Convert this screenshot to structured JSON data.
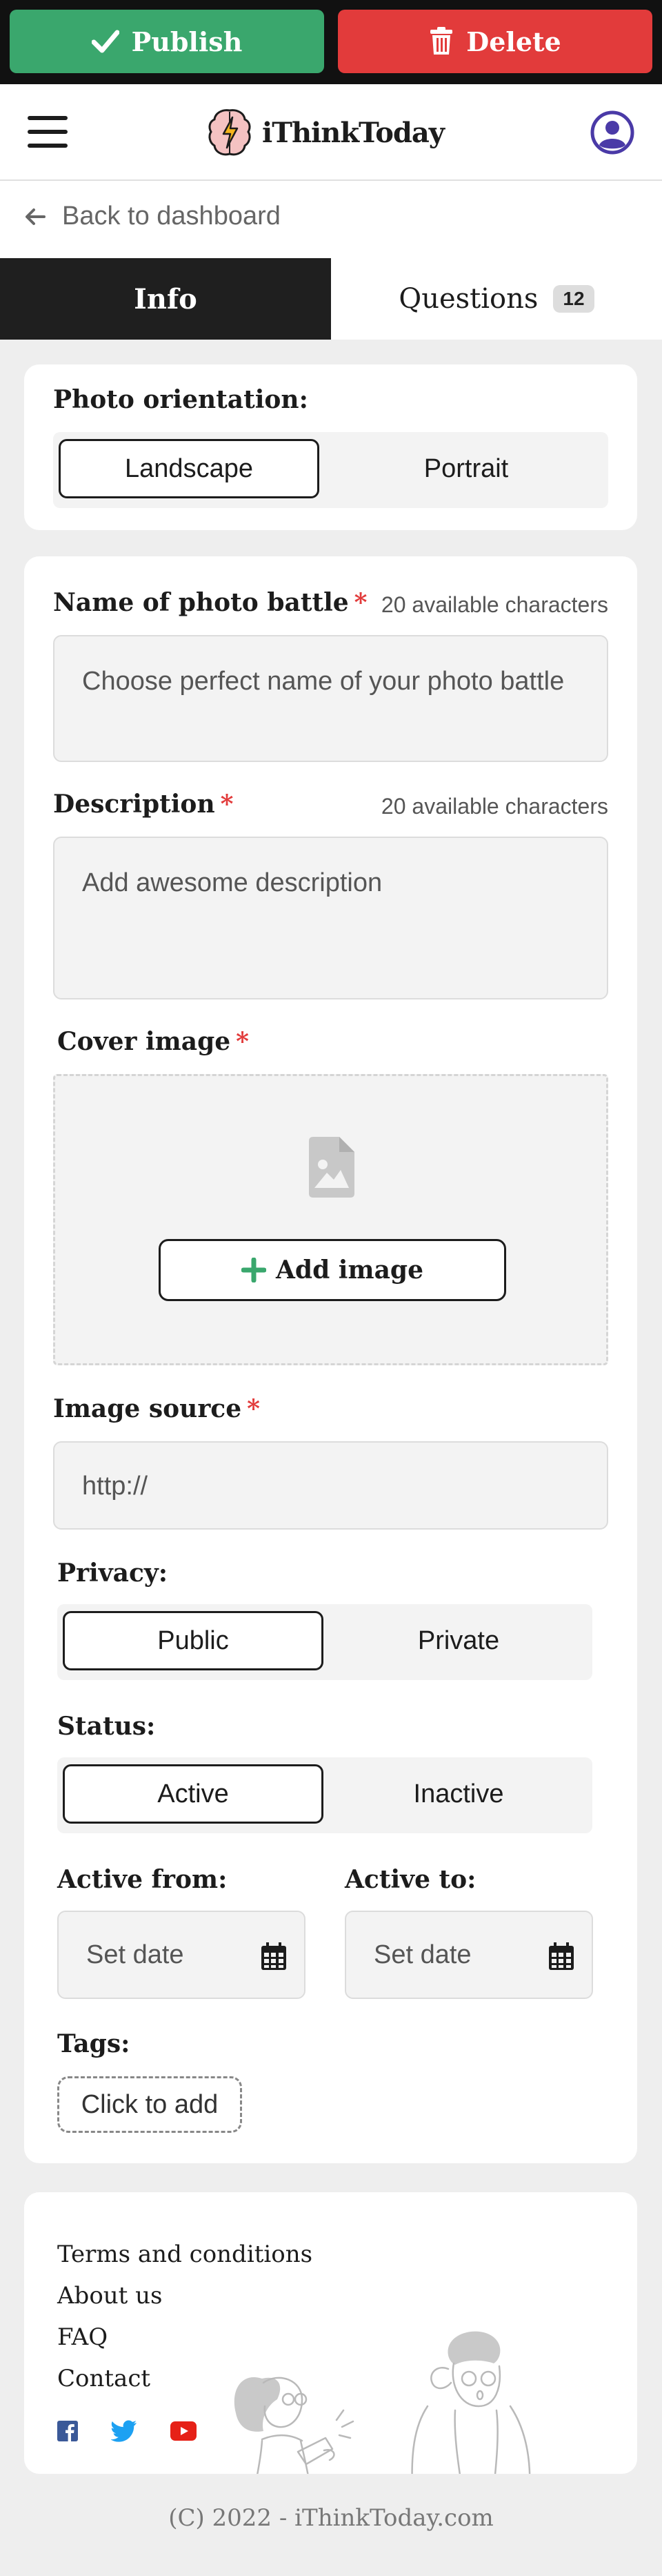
{
  "actions": {
    "publish_label": "Publish",
    "delete_label": "Delete"
  },
  "header": {
    "brand": "iThinkToday"
  },
  "nav": {
    "back_label": "Back to dashboard"
  },
  "tabs": [
    {
      "label": "Info",
      "active": true
    },
    {
      "label": "Questions",
      "badge": "12"
    }
  ],
  "orientation": {
    "label": "Photo orientation:",
    "options": [
      "Landscape",
      "Portrait"
    ],
    "selected": "Landscape"
  },
  "form": {
    "name": {
      "label": "Name of photo battle",
      "required_mark": "*",
      "available": "20 available characters",
      "placeholder": "Choose perfect name of your photo battle"
    },
    "description": {
      "label": "Description",
      "required_mark": "*",
      "available": "20 available characters",
      "placeholder": "Add awesome description"
    },
    "cover": {
      "label": "Cover image",
      "required_mark": "*",
      "add_label": "Add image"
    },
    "source": {
      "label": "Image source",
      "required_mark": "*",
      "placeholder": "http://"
    },
    "privacy": {
      "label": "Privacy:",
      "options": [
        "Public",
        "Private"
      ],
      "selected": "Public"
    },
    "status": {
      "label": "Status:",
      "options": [
        "Active",
        "Inactive"
      ],
      "selected": "Active"
    },
    "active_from": {
      "label": "Active from:",
      "placeholder": "Set date"
    },
    "active_to": {
      "label": "Active to:",
      "placeholder": "Set date"
    },
    "tags": {
      "label": "Tags:",
      "add_label": "Click to add"
    }
  },
  "footer": {
    "links": [
      "Terms and conditions",
      "About us",
      "FAQ",
      "Contact"
    ],
    "social_icons": [
      "facebook-icon",
      "twitter-icon",
      "youtube-icon"
    ],
    "copyright": "(C) 2022 - iThinkToday.com"
  },
  "colors": {
    "publish": "#3aa76d",
    "delete": "#e23b3b",
    "accent": "#4a3aa7",
    "tab_active_bg": "#1f1f1f"
  }
}
